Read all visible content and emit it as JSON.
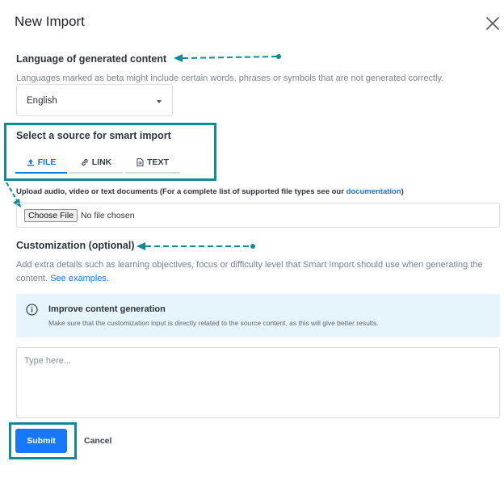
{
  "dialog": {
    "title": "New Import"
  },
  "language": {
    "heading": "Language of generated content",
    "hint": "Languages marked as beta might include certain words, phrases or symbols that are not generated correctly.",
    "selected": "English"
  },
  "source": {
    "heading": "Select a source for smart import",
    "tabs": [
      {
        "label": "FILE",
        "active": true
      },
      {
        "label": "LINK",
        "active": false
      },
      {
        "label": "TEXT",
        "active": false
      }
    ],
    "upload_prefix": "Upload audio, video or text documents (For a complete list of supported file types see our ",
    "upload_link": "documentation",
    "upload_suffix": ")",
    "choose_file_label": "Choose File",
    "no_file_text": "No file chosen"
  },
  "customization": {
    "heading": "Customization (optional)",
    "hint": "Add extra details such as learning objectives, focus or difficulty level that Smart Import should use when generating the content.",
    "examples_link": "See examples.",
    "info_title": "Improve content generation",
    "info_text": "Make sure that the customization input is directly related to the source content, as this will give better results.",
    "placeholder": "Type here..."
  },
  "actions": {
    "submit": "Submit",
    "cancel": "Cancel"
  },
  "colors": {
    "accent": "#1677ff",
    "annotation": "#0f8a97",
    "info_bg": "#e6f4fb"
  }
}
